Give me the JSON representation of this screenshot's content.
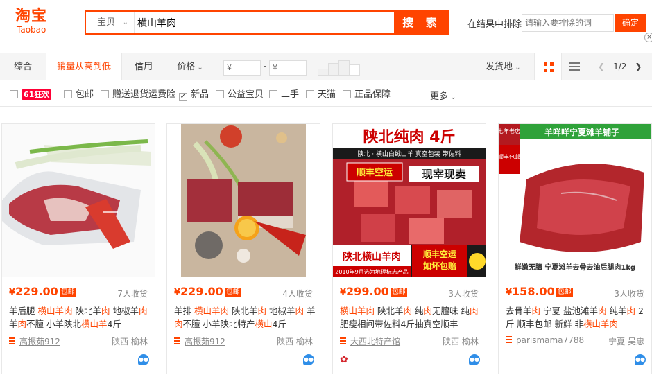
{
  "header": {
    "logo_cn": "淘宝",
    "logo_en": "Taobao",
    "search_scope": "宝贝",
    "search_query": "横山羊肉",
    "search_button": "搜 索",
    "exclude_label": "在结果中排除",
    "exclude_placeholder": "请输入要排除的词",
    "exclude_button": "确定",
    "close_glyph": "×"
  },
  "sortbar": {
    "tabs": [
      "综合",
      "销量从高到低",
      "信用",
      "价格"
    ],
    "price_min": "¥",
    "price_max": "¥",
    "price_dash": "-",
    "ship_from": "发货地",
    "page": "1/2"
  },
  "filters": {
    "promo": "61狂欢",
    "items": [
      "包邮",
      "赠送退货运费险",
      "新品",
      "公益宝贝",
      "二手",
      "天猫",
      "正品保障"
    ],
    "checked": "新品",
    "more": "更多"
  },
  "products": [
    {
      "price": "229.00",
      "badge": "包邮",
      "deals": "7人收货",
      "title_parts": [
        [
          "羊后腿 ",
          false
        ],
        [
          "横山羊肉",
          true
        ],
        [
          " 陕北羊",
          false
        ],
        [
          "肉",
          true
        ],
        [
          " 地椒羊",
          false
        ],
        [
          "肉",
          true
        ],
        [
          " 羊",
          false
        ],
        [
          "肉",
          true
        ],
        [
          "不膻 小羊陕北",
          false
        ],
        [
          "横山羊",
          true
        ],
        [
          "4斤",
          false
        ]
      ],
      "shop": "高振茹912",
      "location": "陕西  榆林"
    },
    {
      "price": "229.00",
      "badge": "包邮",
      "deals": "4人收货",
      "title_parts": [
        [
          "羊排 ",
          false
        ],
        [
          "横山羊肉",
          true
        ],
        [
          " 陕北羊",
          false
        ],
        [
          "肉",
          true
        ],
        [
          " 地椒羊",
          false
        ],
        [
          "肉",
          true
        ],
        [
          " 羊",
          false
        ],
        [
          "肉",
          true
        ],
        [
          "不膻 小羊陕北特产",
          false
        ],
        [
          "横山",
          true
        ],
        [
          "4斤",
          false
        ]
      ],
      "shop": "高振茹912",
      "location": "陕西  榆林"
    },
    {
      "price": "299.00",
      "badge": "包邮",
      "deals": "3人收货",
      "title_parts": [
        [
          "横山羊肉",
          true
        ],
        [
          " 陕北羊",
          false
        ],
        [
          "肉",
          true
        ],
        [
          " 纯",
          false
        ],
        [
          "肉",
          true
        ],
        [
          "无膻味 纯",
          false
        ],
        [
          "肉",
          true
        ],
        [
          "肥瘦相间带佐料4斤抽真空顺丰",
          false
        ]
      ],
      "shop": "大西北特产馆",
      "location": "陕西  榆林",
      "image": {
        "banner": "陕北纯肉  4斤",
        "sub": "陕北 · 横山白绒山羊  真空包装  带佐料",
        "ship": "顺丰空运",
        "fresh": "现宰现卖",
        "bottom_left": "陕北横山羊肉",
        "bottom_right": "顺丰空运\n如坏包赔",
        "foot": "2010年9月选为地理标志产品"
      }
    },
    {
      "price": "158.00",
      "badge": "包邮",
      "deals": "3人收货",
      "title_parts": [
        [
          "去骨羊",
          false
        ],
        [
          "肉",
          true
        ],
        [
          " 宁夏 盐池滩羊",
          false
        ],
        [
          "肉",
          true
        ],
        [
          " 纯羊",
          false
        ],
        [
          "肉",
          true
        ],
        [
          " 2斤 顺丰包邮 新鲜 非",
          false
        ],
        [
          "横山羊肉",
          true
        ]
      ],
      "shop": "parismama7788",
      "location": "宁夏  吴忠",
      "image": {
        "banner": "羊咩咩宁夏滩羊铺子",
        "tag": "七年老店",
        "shipfree": "顺丰包邮",
        "foot": "鲜嫩无膻  宁夏滩羊去骨去油后腿肉1kg"
      }
    }
  ],
  "colors": {
    "accent": "#ff4400",
    "promo": "#ff0036"
  }
}
